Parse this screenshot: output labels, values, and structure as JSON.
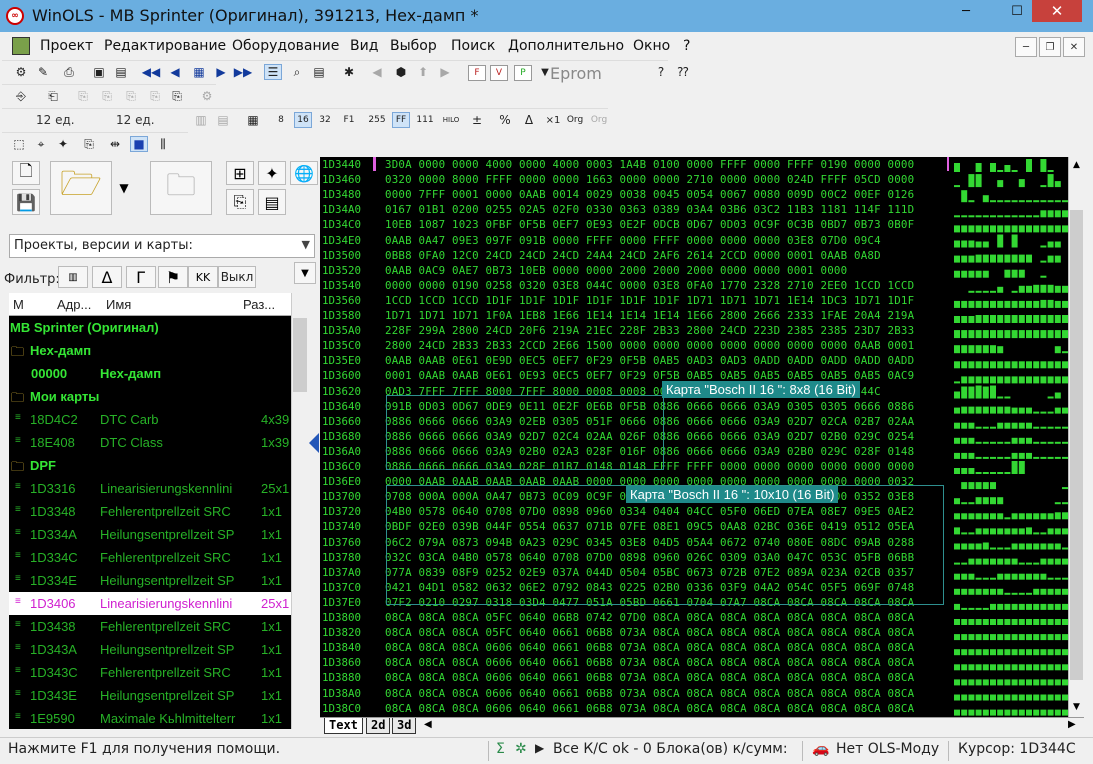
{
  "window": {
    "title": "WinOLS - MB Sprinter (Оригинал), 391213, Hex-дамп *",
    "minimize": "─",
    "maximize": "☐",
    "close": "✕"
  },
  "menu": [
    "Проект",
    "Редактирование",
    "Оборудование",
    "Вид",
    "Выбор",
    "Поиск",
    "Дополнительно",
    "Окно",
    "?"
  ],
  "toolbar": {
    "eprom_label": "Eprom",
    "width_label_1": "12 ед.",
    "width_label_2": "12 ед.",
    "accent": "#123a9c"
  },
  "left_panel": {
    "project_select": "Проекты, версии и карты:",
    "filter_label": "Фильтр:",
    "filter_off": "Выкл",
    "tree_headers": [
      "M",
      "Адр...",
      "Имя",
      "Раз..."
    ],
    "tree_items": [
      {
        "kind": "project",
        "addr": "",
        "name": "MB Sprinter (Оригинал)",
        "size": ""
      },
      {
        "kind": "folder",
        "addr": "",
        "name": "Hex-дамп",
        "size": ""
      },
      {
        "kind": "entry",
        "addr": "00000",
        "name": "Hex-дамп",
        "size": "",
        "bold": true
      },
      {
        "kind": "folder",
        "addr": "",
        "name": "Мои карты",
        "size": ""
      },
      {
        "kind": "map",
        "addr": "18D4C2",
        "name": "DTC Carb",
        "size": "4x39"
      },
      {
        "kind": "map",
        "addr": "18E408",
        "name": "DTC Class",
        "size": "1x39"
      },
      {
        "kind": "folder",
        "addr": "",
        "name": "DPF",
        "size": ""
      },
      {
        "kind": "map",
        "addr": "1D3316",
        "name": "Linearisierungskennlini",
        "size": "25x1"
      },
      {
        "kind": "map",
        "addr": "1D3348",
        "name": "Fehlerentprellzeit SRC",
        "size": "1x1"
      },
      {
        "kind": "map",
        "addr": "1D334A",
        "name": "Heilungsentprellzeit SP",
        "size": "1x1"
      },
      {
        "kind": "map",
        "addr": "1D334C",
        "name": "Fehlerentprellzeit SRC",
        "size": "1x1"
      },
      {
        "kind": "map",
        "addr": "1D334E",
        "name": "Heilungsentprellzeit SP",
        "size": "1x1"
      },
      {
        "kind": "map",
        "addr": "1D3406",
        "name": "Linearisierungskennlini",
        "size": "25x1",
        "selected": true
      },
      {
        "kind": "map",
        "addr": "1D3438",
        "name": "Fehlerentprellzeit SRC",
        "size": "1x1"
      },
      {
        "kind": "map",
        "addr": "1D343A",
        "name": "Heilungsentprellzeit SP",
        "size": "1x1"
      },
      {
        "kind": "map",
        "addr": "1D343C",
        "name": "Fehlerentprellzeit SRC",
        "size": "1x1"
      },
      {
        "kind": "map",
        "addr": "1D343E",
        "name": "Heilungsentprellzeit SP",
        "size": "1x1"
      },
      {
        "kind": "map",
        "addr": "1E9590",
        "name": "Maximale Kьhlmittelterr",
        "size": "1x1"
      }
    ]
  },
  "hex": {
    "rows": [
      [
        "1D3440",
        "3D0A 0000 0000 4000 0000 4000 0003 1A4B 0100 0000 FFFF 0000 FFFF 0190 0000 0000"
      ],
      [
        "1D3460",
        "0320 0000 8000 FFFF 0000 0000 1663 0000 0000 2710 0000 0000 024D FFFF 05CD 0000"
      ],
      [
        "1D3480",
        "0000 7FFF 0001 0000 0AAB 0014 0029 0038 0045 0054 0067 0080 009D 00C2 00EF 0126"
      ],
      [
        "1D34A0",
        "0167 01B1 0200 0255 02A5 02F0 0330 0363 0389 03A4 03B6 03C2 11B3 1181 114F 111D"
      ],
      [
        "1D34C0",
        "10EB 1087 1023 0FBF 0F5B 0EF7 0E93 0E2F 0DCB 0D67 0D03 0C9F 0C3B 0BD7 0B73 0B0F"
      ],
      [
        "1D34E0",
        "0AAB 0A47 09E3 097F 091B 0000 FFFF 0000 FFFF 0000 0000 0000 03E8 07D0 09C4"
      ],
      [
        "1D3500",
        "0BB8 0FA0 12C0 24CD 24CD 24CD 24A4 24CD 2AF6 2614 2CCD 0000 0001 0AAB 0A8D"
      ],
      [
        "1D3520",
        "0AAB 0AC9 0AE7 0B73 10EB 0000 0000 2000 2000 2000 0000 0000 0001 0000"
      ],
      [
        "1D3540",
        "0000 0000 0190 0258 0320 03E8 044C 0000 03E8 0FA0 1770 2328 2710 2EE0 1CCD 1CCD"
      ],
      [
        "1D3560",
        "1CCD 1CCD 1CCD 1D1F 1D1F 1D1F 1D1F 1D1F 1D1F 1D71 1D71 1D71 1E14 1DC3 1D71 1D1F"
      ],
      [
        "1D3580",
        "1D71 1D71 1D71 1F0A 1EB8 1E66 1E14 1E14 1E14 1E66 2800 2666 2333 1FAE 20A4 219A"
      ],
      [
        "1D35A0",
        "228F 299A 2800 24CD 20F6 219A 21EC 228F 2B33 2800 24CD 223D 2385 2385 23D7 2B33"
      ],
      [
        "1D35C0",
        "2800 24CD 2B33 2B33 2CCD 2E66 1500 0000 0000 0000 0000 0000 0000 0000 0AAB 0001"
      ],
      [
        "1D35E0",
        "0AAB 0AAB 0E61 0E9D 0EC5 0EF7 0F29 0F5B 0AB5 0AD3 0AD3 0ADD 0ADD 0ADD 0ADD 0ADD"
      ],
      [
        "1D3600",
        "0001 0AAB 0AAB 0E61 0E93 0EC5 0EF7 0F29 0F5B 0AB5 0AB5 0AB5 0AB5 0AB5 0AB5 0AC9"
      ],
      [
        "1D3620",
        "0AD3 7FFF 7FFF 8000 7FFF 8000 0008 0008 0000 0000 0000 0000 0000 0320 044C"
      ],
      [
        "1D3640",
        "091B 0D03 0D67 0DE9 0E11 0E2F 0E6B 0F5B 0886 0666 0666 03A9 0305 0305 0666 0886"
      ],
      [
        "1D3660",
        "0886 0666 0666 03A9 02EB 0305 051F 0666 0886 0666 0666 03A9 02D7 02CA 02B7 02AA"
      ],
      [
        "1D3680",
        "0886 0666 0666 03A9 02D7 02C4 02AA 026F 0886 0666 0666 03A9 02D7 02B0 029C 0254"
      ],
      [
        "1D36A0",
        "0886 0666 0666 03A9 02B0 02A3 028F 016F 0886 0666 0666 03A9 02B0 029C 028F 0148"
      ],
      [
        "1D36C0",
        "0886 0666 0666 03A9 028F 01B7 0148 0148 FFFF FFFF 0000 0000 0000 0000 0000 0000"
      ],
      [
        "1D36E0",
        "0000 0AAB 0AAB 0AAB 0AAB 0AAB 0000 0000 0000 0000 0000 0000 0000 0000 0000 0032"
      ],
      [
        "1D3700",
        "0708 000A 000A 0A47 0B73 0C09 0C9F 0000 0000 0000 0000 0000 0000 0000 0352 03E8"
      ],
      [
        "1D3720",
        "04B0 0578 0640 0708 07D0 0898 0960 0334 0404 04CC 05F0 06ED 07EA 08E7 09E5 0AE2"
      ],
      [
        "1D3740",
        "0BDF 02E0 039B 044F 0554 0637 071B 07FE 08E1 09C5 0AA8 02BC 036E 0419 0512 05EA"
      ],
      [
        "1D3760",
        "06C2 079A 0873 094B 0A23 029C 0345 03E8 04D5 05A4 0672 0740 080E 08DC 09AB 0288"
      ],
      [
        "1D3780",
        "032C 03CA 04B0 0578 0640 0708 07D0 0898 0960 026C 0309 03A0 047C 053C 05FB 06BB"
      ],
      [
        "1D37A0",
        "077A 0839 08F9 0252 02E9 037A 044D 0504 05BC 0673 072B 07E2 089A 023A 02CB 0357"
      ],
      [
        "1D37C0",
        "0421 04D1 0582 0632 06E2 0792 0843 0225 02B0 0336 03F9 04A2 054C 05F5 069F 0748"
      ],
      [
        "1D37E0",
        "07F2 0210 0297 0318 03D4 0477 051A 05BD 0661 0704 07A7 08CA 08CA 08CA 08CA 08CA"
      ],
      [
        "1D3800",
        "08CA 08CA 08CA 05FC 0640 06B8 0742 07D0 08CA 08CA 08CA 08CA 08CA 08CA 08CA 08CA"
      ],
      [
        "1D3820",
        "08CA 08CA 08CA 05FC 0640 0661 06B8 073A 08CA 08CA 08CA 08CA 08CA 08CA 08CA 08CA"
      ],
      [
        "1D3840",
        "08CA 08CA 08CA 0606 0640 0661 06B8 073A 08CA 08CA 08CA 08CA 08CA 08CA 08CA 08CA"
      ],
      [
        "1D3860",
        "08CA 08CA 08CA 0606 0640 0661 06B8 073A 08CA 08CA 08CA 08CA 08CA 08CA 08CA 08CA"
      ],
      [
        "1D3880",
        "08CA 08CA 08CA 0606 0640 0661 06B8 073A 08CA 08CA 08CA 08CA 08CA 08CA 08CA 08CA"
      ],
      [
        "1D38A0",
        "08CA 08CA 08CA 0606 0640 0661 06B8 073A 08CA 08CA 08CA 08CA 08CA 08CA 08CA 08CA"
      ],
      [
        "1D38C0",
        "08CA 08CA 08CA 0606 0640 0661 06B8 073A 08CA 08CA 08CA 08CA 08CA 08CA 08CA 08CA"
      ]
    ],
    "map_label_1": "Карта \"Bosch II 16 \": 8x8 (16 Bit)",
    "map_label_2": "Карта \"Bosch II 16 \": 10x10 (16 Bit)",
    "view_tabs": [
      "Text",
      "2d",
      "3d"
    ],
    "text_color": "#33d833",
    "map_color": "#1f8a8a"
  },
  "status": {
    "help": "Нажмите F1 для получения помощи.",
    "checksum": "Все К/С ok - 0 Блока(ов) к/сумм:",
    "ols_module": "Нет OLS-Моду",
    "cursor": "Курсор: 1D344C"
  }
}
